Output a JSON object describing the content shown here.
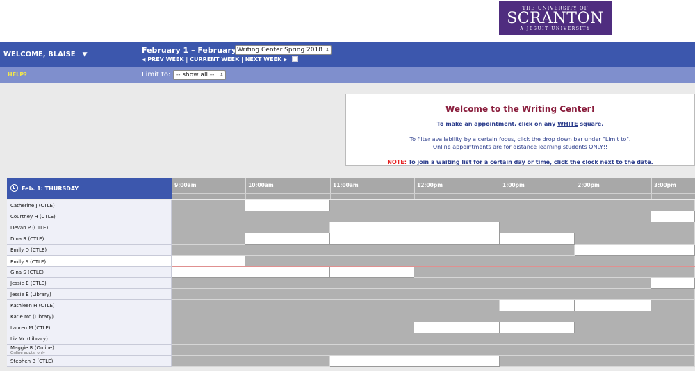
{
  "logo": {
    "line1": "THE UNIVERSITY OF",
    "line2": "SCRANTON",
    "line3": "A JESUIT UNIVERSITY",
    "color": "#4f2d7f"
  },
  "nav": {
    "welcome": "WELCOME, BLAISE",
    "week_title": "February 1 – February 7",
    "schedule_select": "Writing Center Spring 2018",
    "prev_week": "PREV WEEK",
    "current_week": "CURRENT WEEK",
    "next_week": "NEXT WEEK",
    "separator": "|"
  },
  "helpbar": {
    "help": "HELP?",
    "limit_label": "Limit to:",
    "limit_select": "-- show all --"
  },
  "welcome_box": {
    "title": "Welcome to the Writing Center!",
    "line1_pre": "To make an appointment, click on any",
    "line1_white": "WHITE",
    "line1_post": "square.",
    "line2a": "To filter availability by a certain focus, click the drop down bar under \"Limit to\".",
    "line2b": "Online appointments are for distance learning students ONLY!!",
    "note_label": "NOTE:",
    "note_text": "To join a waiting list for a certain day or time, click the clock next to the date."
  },
  "grid": {
    "day_label": "Feb. 1: THURSDAY",
    "times": [
      "9:00am",
      "10:00am",
      "11:00am",
      "12:00pm",
      "1:00pm",
      "2:00pm",
      "3:00pm"
    ],
    "colors": {
      "booked": "#b1b1b1",
      "open": "#ffffff",
      "header": "#3c57ad"
    },
    "rows": [
      {
        "name": "Catherine J (CTLE)",
        "cells": "BWBBBBB"
      },
      {
        "name": "Courtney H (CTLE)",
        "cells": "BBBBBBW"
      },
      {
        "name": "Devan P (CTLE)",
        "cells": "BBWWBBB"
      },
      {
        "name": "Dina R (CTLE)",
        "cells": "BWWWWBB"
      },
      {
        "name": "Emily D (CTLE)",
        "cells": "BBBBBWW"
      },
      {
        "name": "Emily S (CTLE)",
        "cells": "WBBBBBB",
        "highlight": true
      },
      {
        "name": "Gina S (CTLE)",
        "cells": "WWWBBBB"
      },
      {
        "name": "Jessie E (CTLE)",
        "cells": "BBBBBBW"
      },
      {
        "name": "Jessie E (Library)",
        "cells": "BBBBBBB"
      },
      {
        "name": "Kathleen H (CTLE)",
        "cells": "BBBBWWB"
      },
      {
        "name": "Katie Mc (Library)",
        "cells": "BBBBBBB"
      },
      {
        "name": "Lauren M (CTLE)",
        "cells": "BBBWWBB"
      },
      {
        "name": "Liz Mc (Library)",
        "cells": "BBBBBBB"
      },
      {
        "name": "Maggie R (Online)",
        "sub": "Online appts. only",
        "cells": "BBBBBBB"
      },
      {
        "name": "Stephen B (CTLE)",
        "cells": "BBWWBBB"
      }
    ]
  }
}
